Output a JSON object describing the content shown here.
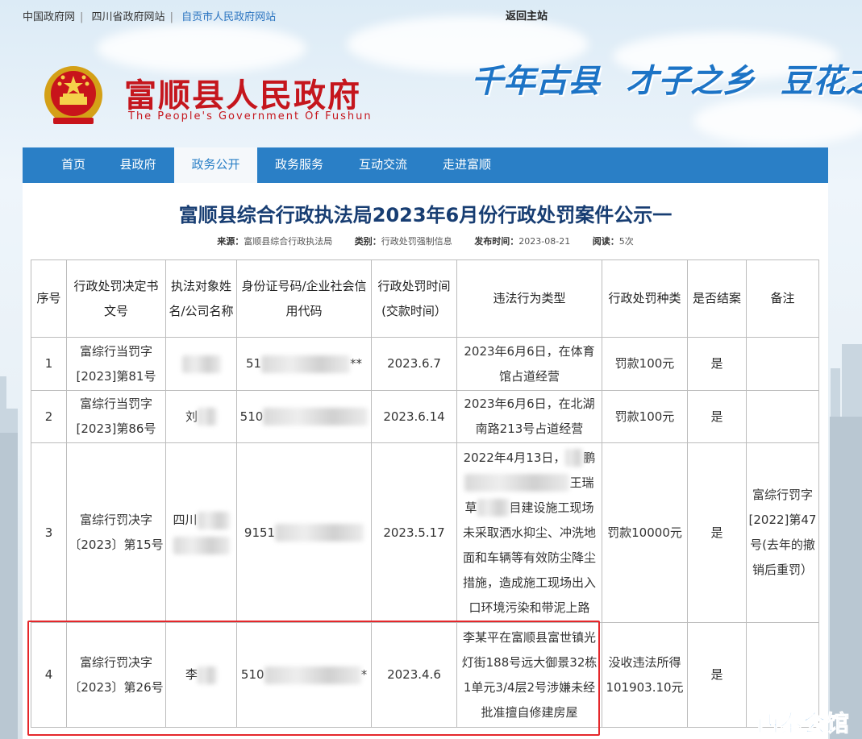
{
  "topbar": {
    "links": [
      "中国政府网",
      "四川省政府网站",
      "自贡市人民政府网站"
    ],
    "back_home": "返回主站"
  },
  "header": {
    "site_name": "富顺县人民政府",
    "site_sub": "The People's Government Of Fushun",
    "slogans": [
      "千年古县",
      "才子之乡",
      "豆花之"
    ]
  },
  "nav": {
    "items": [
      "首页",
      "县政府",
      "政务公开",
      "政务服务",
      "互动交流",
      "走进富顺"
    ],
    "active": "政务公开"
  },
  "article": {
    "title": "富顺县综合行政执法局2023年6月份行政处罚案件公示一",
    "source_label": "来源：",
    "source": "富顺县综合行政执法局",
    "category_label": "类别：",
    "category": "行政处罚强制信息",
    "date_label": "发布时间：",
    "date": "2023-08-21",
    "views_label": "阅读：",
    "views": "5次"
  },
  "table": {
    "headers": [
      "序号",
      "行政处罚决定书文号",
      "执法对象姓名/公司名称",
      "身份证号码/企业社会信用代码",
      "行政处罚时间(交款时间）",
      "违法行为类型",
      "行政处罚种类",
      "是否结案",
      "备注"
    ],
    "rows": [
      {
        "no": "1",
        "doc": "富综行当罚字[2023]第81号",
        "name": "",
        "id": "51",
        "id_tail": "**",
        "time": "2023.6.7",
        "violation": "2023年6月6日，在体育馆占道经营",
        "penalty": "罚款100元",
        "closed": "是",
        "note": ""
      },
      {
        "no": "2",
        "doc": "富综行当罚字[2023]第86号",
        "name": "刘",
        "id": "510",
        "id_tail": "",
        "time": "2023.6.14",
        "violation": "2023年6月6日，在北湖南路213号占道经营",
        "penalty": "罚款100元",
        "closed": "是",
        "note": ""
      },
      {
        "no": "3",
        "doc": "富综行罚决字〔2023〕第15号",
        "name": "四川",
        "id": "9151",
        "id_tail": "",
        "time": "2023.5.17",
        "violation_lines": [
          "2022年4月13日，",
          "鹏",
          "王瑞",
          "草",
          "目建设施工现场",
          "未采取洒水抑尘、冲洗地",
          "面和车辆等有效防尘降尘",
          "措施，造成施工现场出入",
          "口环境污染和带泥上路"
        ],
        "penalty": "罚款10000元",
        "closed": "是",
        "note": "富综行罚字[2022]第47号(去年的撤销后重罚）"
      },
      {
        "no": "4",
        "doc": "富综行罚决字〔2023〕第26号",
        "name": "李",
        "id": "510",
        "id_tail": "*",
        "time": "2023.4.6",
        "violation": "李某平在富顺县富世镇光灯街188号远大御景32栋1单元3/4层2号涉嫌未经批准擅自修建房屋",
        "penalty": "没收违法所得101903.10元",
        "closed": "是",
        "note": ""
      }
    ]
  },
  "watermark": "西秦会馆"
}
